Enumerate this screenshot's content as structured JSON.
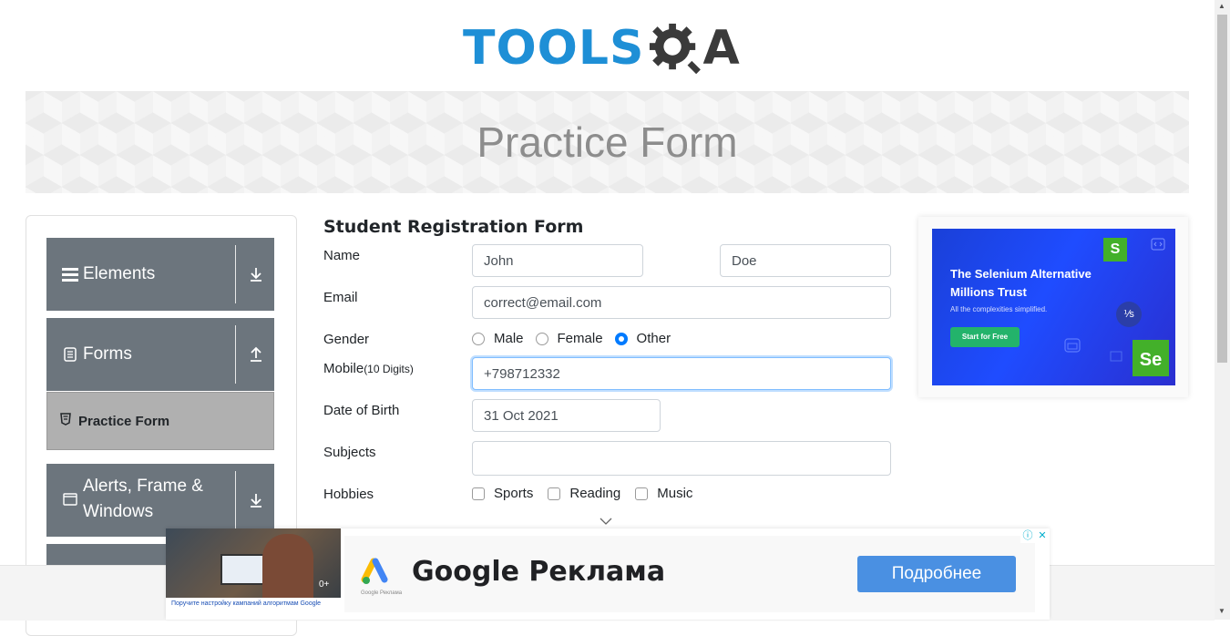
{
  "header": {
    "logo_left": "TOOLS",
    "logo_right": "A"
  },
  "banner": {
    "title": "Practice Form"
  },
  "sidebar": {
    "groups": [
      {
        "label": "Elements",
        "icon": "menu-icon",
        "arrow": "download-arrow-icon"
      },
      {
        "label": "Forms",
        "icon": "document-icon",
        "arrow": "upload-arrow-icon"
      },
      {
        "label": "Alerts, Frame & Windows",
        "icon": "window-icon",
        "arrow": "download-arrow-icon"
      }
    ],
    "active_item": {
      "label": "Practice Form",
      "icon": "html-icon"
    }
  },
  "form": {
    "title": "Student Registration Form",
    "name_label": "Name",
    "first_name": "John",
    "last_name": "Doe",
    "email_label": "Email",
    "email": "correct@email.com",
    "gender_label": "Gender",
    "gender_options": [
      "Male",
      "Female",
      "Other"
    ],
    "gender_selected": "Other",
    "mobile_label": "Mobile",
    "mobile_hint": "(10 Digits)",
    "mobile": "+798712332",
    "dob_label": "Date of Birth",
    "dob": "31 Oct 2021",
    "subjects_label": "Subjects",
    "subjects": "",
    "hobbies_label": "Hobbies",
    "hobbies": [
      "Sports",
      "Reading",
      "Music"
    ]
  },
  "side_ad": {
    "title_line1": "The Selenium Alternative",
    "title_line2": "Millions Trust",
    "subtitle": "All the complexities simplified.",
    "button": "Start for Free",
    "badge_s": "S",
    "badge_se": "Se",
    "circle": "⅟s"
  },
  "bottom_ad": {
    "headline": "Google Реклама",
    "button": "Подробнее",
    "small_brand": "Google Реклама",
    "caption": "Поручите настройку кампаний алгоритмам Google",
    "badge": "0+"
  },
  "colors": {
    "accent": "#1e8fd6",
    "sidebar_header": "#6c757d",
    "active_item": "#b0b0b0",
    "ad_bg": "#1f4cff",
    "ad_button": "#4a90e2"
  }
}
